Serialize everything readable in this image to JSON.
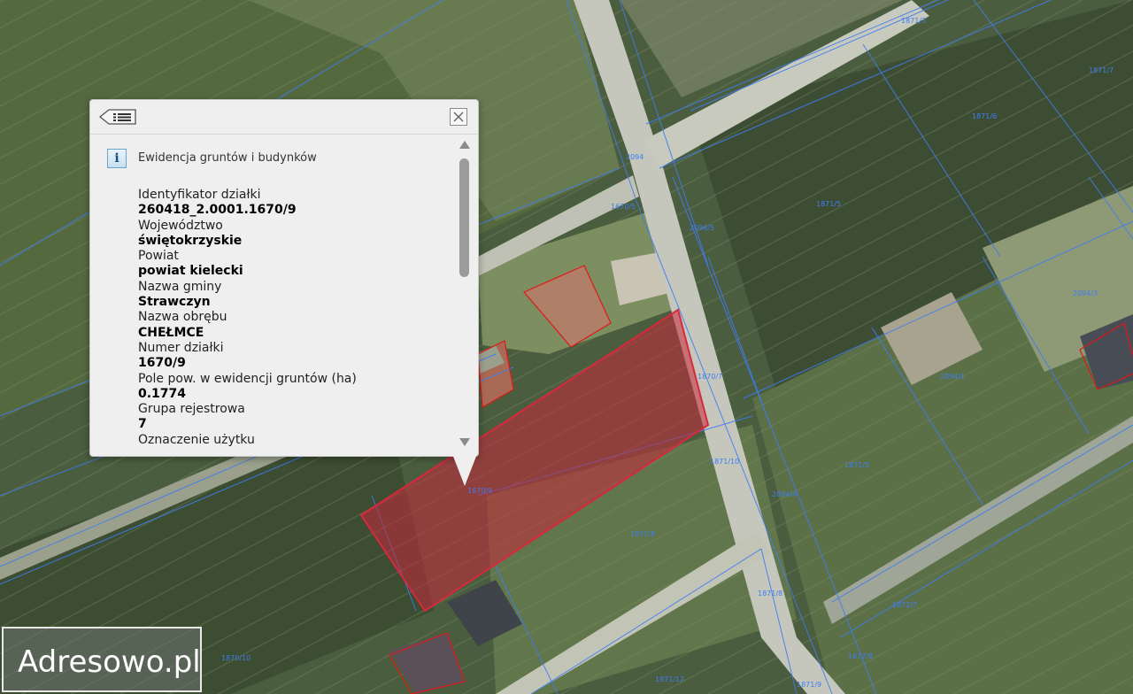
{
  "popup": {
    "title": "Ewidencja gruntów i budynków",
    "info_icon": "i",
    "menu_icon": "list-menu-icon",
    "close_icon": "close-icon",
    "fields": [
      {
        "label": "Identyfikator działki",
        "value": "260418_2.0001.1670/9"
      },
      {
        "label": "Województwo",
        "value": "świętokrzyskie"
      },
      {
        "label": "Powiat",
        "value": "powiat kielecki"
      },
      {
        "label": "Nazwa gminy",
        "value": "Strawczyn"
      },
      {
        "label": "Nazwa obrębu",
        "value": "CHEŁMCE"
      },
      {
        "label": "Numer działki",
        "value": "1670/9"
      },
      {
        "label": "Pole pow. w ewidencji gruntów (ha)",
        "value": "0.1774"
      },
      {
        "label": "Grupa rejestrowa",
        "value": "7"
      },
      {
        "label": "Oznaczenie użytku",
        "value": ""
      }
    ]
  },
  "map": {
    "selected_parcel": "1670/9",
    "parcel_labels": [
      "1871/3",
      "1871/7",
      "1871/6",
      "2094",
      "1670/5",
      "1871/5",
      "2096/5",
      "1870/7",
      "2094/3",
      "2094/1",
      "1670/9",
      "1871/10",
      "1871/8",
      "2094/4",
      "1871/5",
      "1872/7",
      "1870/10",
      "1871/12",
      "1871/8",
      "1871/9",
      "1677/8"
    ],
    "colors": {
      "parcel_line": "#3f7cf2",
      "selection_fill": "#c8283c",
      "building_outline": "#e01818"
    }
  },
  "logo": {
    "text": "Adresowo.pl"
  }
}
